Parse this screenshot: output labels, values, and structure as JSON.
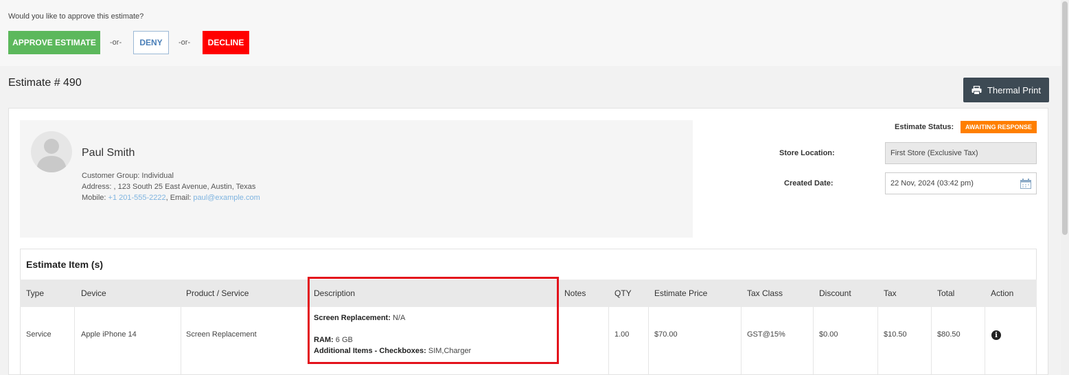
{
  "approval": {
    "question": "Would you like to approve this estimate?",
    "approve_label": "APPROVE ESTIMATE",
    "or1": "-or-",
    "deny_label": "DENY",
    "or2": "-or-",
    "decline_label": "DECLINE"
  },
  "header": {
    "title": "Estimate # 490",
    "print_label": "Thermal Print",
    "print_icon": "printer-icon"
  },
  "customer": {
    "name": "Paul Smith",
    "group_text": "Customer Group: Individual",
    "address_text": "Address: , 123 South 25 East Avenue, Austin, Texas",
    "mobile_label": "Mobile: ",
    "mobile": "+1 201-555-2222",
    "email_label": ", Email: ",
    "email": "paul@example.com"
  },
  "meta": {
    "status_label": "Estimate Status:",
    "status_value": "AWAITING RESPONSE",
    "store_label": "Store Location:",
    "store_value": "First Store (Exclusive Tax)",
    "date_label": "Created Date:",
    "date_value": "22 Nov, 2024 (03:42 pm)"
  },
  "items": {
    "title": "Estimate Item (s)",
    "columns": [
      "Type",
      "Device",
      "Product / Service",
      "Description",
      "Notes",
      "QTY",
      "Estimate Price",
      "Tax Class",
      "Discount",
      "Tax",
      "Total",
      "Action"
    ],
    "rows": [
      {
        "type": "Service",
        "device": "Apple iPhone 14",
        "product": "Screen Replacement",
        "description": [
          {
            "label": "Screen Replacement:",
            "value": " N/A"
          },
          {
            "label": "RAM:",
            "value": " 6 GB"
          },
          {
            "label": "Additional Items - Checkboxes:",
            "value": " SIM,Charger"
          }
        ],
        "notes": "",
        "qty": "1.00",
        "price": "$70.00",
        "tax_class": "GST@15%",
        "discount": "$0.00",
        "tax": "$10.50",
        "total": "$80.50",
        "action_icon": "info-icon"
      }
    ]
  },
  "colors": {
    "approve": "#5cb85c",
    "decline": "#ff0000",
    "status": "#ff7f00",
    "highlight": "#e3121b"
  }
}
